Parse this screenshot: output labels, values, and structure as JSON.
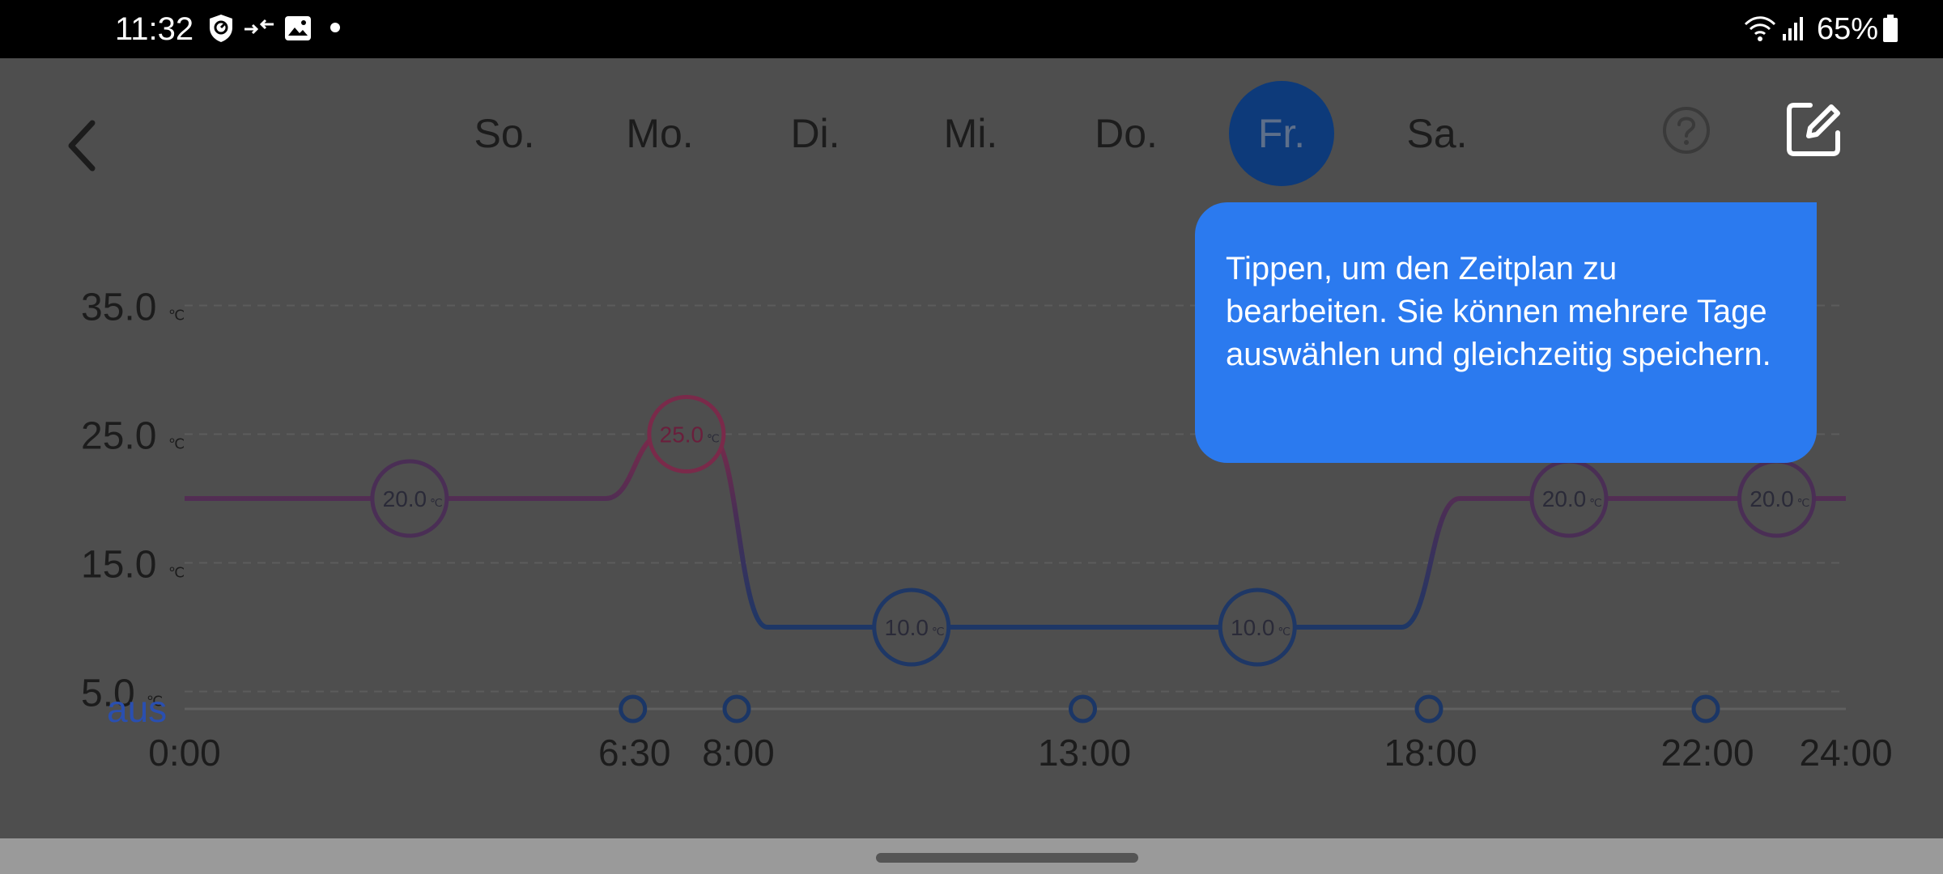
{
  "status_bar": {
    "time": "11:32",
    "battery": "65%",
    "icons": [
      "shield-check-icon",
      "data-transfer-icon",
      "gallery-icon",
      "notification-dot-icon",
      "wifi-icon",
      "signal-icon",
      "battery-icon"
    ]
  },
  "header": {
    "back_icon": "chevron-left-icon",
    "days": [
      {
        "label": "So.",
        "active": false
      },
      {
        "label": "Mo.",
        "active": false
      },
      {
        "label": "Di.",
        "active": false
      },
      {
        "label": "Mi.",
        "active": false
      },
      {
        "label": "Do.",
        "active": false
      },
      {
        "label": "Fr.",
        "active": true
      },
      {
        "label": "Sa.",
        "active": false
      }
    ],
    "help_icon": "help-circle-icon",
    "edit_icon": "edit-icon"
  },
  "tooltip": {
    "text": "Tippen, um den Zeitplan zu bearbeiten. Sie können mehrere Tage auswählen und gleichzeitig speichern."
  },
  "chart_data": {
    "type": "line",
    "y_unit": "℃",
    "y_ticks": [
      "35.0",
      "25.0",
      "15.0",
      "5.0"
    ],
    "y_off_label": "aus",
    "x_ticks": [
      "0:00",
      "6:30",
      "8:00",
      "13:00",
      "18:00",
      "22:00",
      "24:00"
    ],
    "xlim": [
      0,
      24
    ],
    "ylim": [
      0,
      35
    ],
    "grid": true,
    "switch_times": [
      6.5,
      8,
      13,
      18,
      22
    ],
    "segments": [
      {
        "start": 0,
        "end": 6.5,
        "temp": 20.0,
        "label": "20.0"
      },
      {
        "start": 6.5,
        "end": 8,
        "temp": 25.0,
        "label": "25.0"
      },
      {
        "start": 8,
        "end": 13,
        "temp": 10.0,
        "label": "10.0"
      },
      {
        "start": 13,
        "end": 18,
        "temp": 10.0,
        "label": "10.0"
      },
      {
        "start": 18,
        "end": 22,
        "temp": 20.0,
        "label": "20.0"
      },
      {
        "start": 22,
        "end": 24,
        "temp": 20.0,
        "label": "20.0"
      }
    ],
    "colors": {
      "warm": "#7a2a4a",
      "mid": "#4a2e55",
      "cool": "#1e3766",
      "axis_text": "#1c1c1c",
      "off_text": "#2a4fb0",
      "grid": "#5c5c5c"
    }
  }
}
